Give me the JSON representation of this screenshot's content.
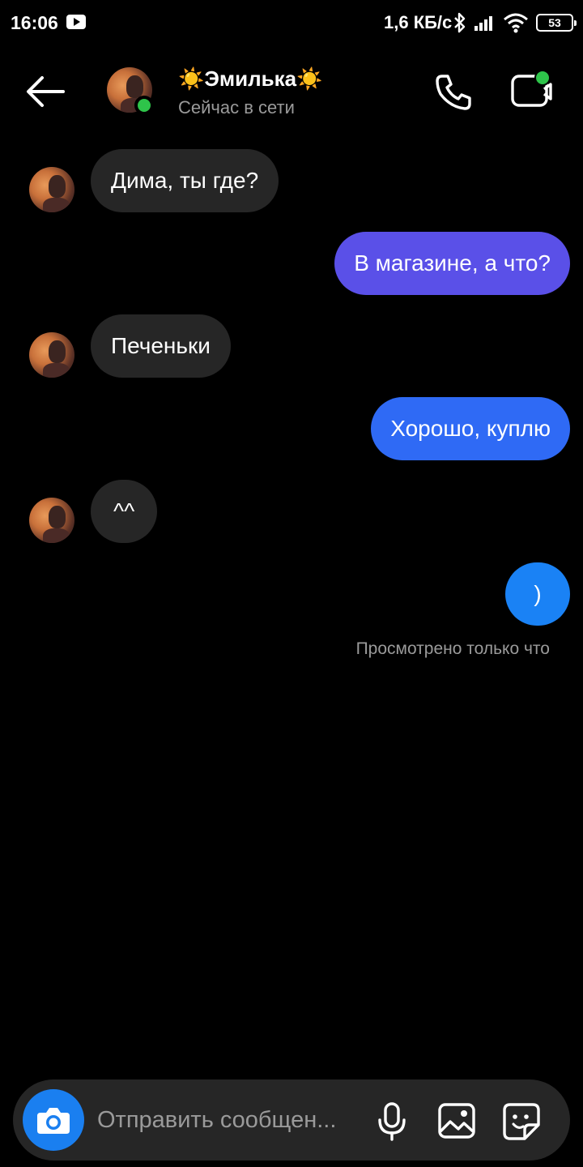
{
  "status_bar": {
    "time": "16:06",
    "net_speed": "1,6 КБ/с",
    "battery": "53",
    "icons": [
      "youtube-icon",
      "bluetooth-icon",
      "signal-icon",
      "wifi-icon",
      "battery-icon"
    ]
  },
  "header": {
    "contact_name": "☀️Эмилька☀️",
    "contact_status": "Сейчас в сети",
    "online_color": "#2ec44a"
  },
  "messages": [
    {
      "direction": "incoming",
      "text": "Дима, ты где?"
    },
    {
      "direction": "outgoing",
      "text": "В магазине, а что?"
    },
    {
      "direction": "incoming",
      "text": "Печеньки"
    },
    {
      "direction": "outgoing",
      "text": "Хорошо, куплю"
    },
    {
      "direction": "incoming",
      "text": "^^"
    },
    {
      "direction": "outgoing",
      "text": ")"
    }
  ],
  "seen_status": "Просмотрено только что",
  "composer": {
    "placeholder": "Отправить сообщен..."
  },
  "colors": {
    "background": "#000000",
    "incoming_bubble": "#262626",
    "outgoing_gradient": [
      "#6a4ae0",
      "#4a5cf0",
      "#2a6ef8",
      "#1a82f5"
    ],
    "accent": "#1a7ff0"
  }
}
